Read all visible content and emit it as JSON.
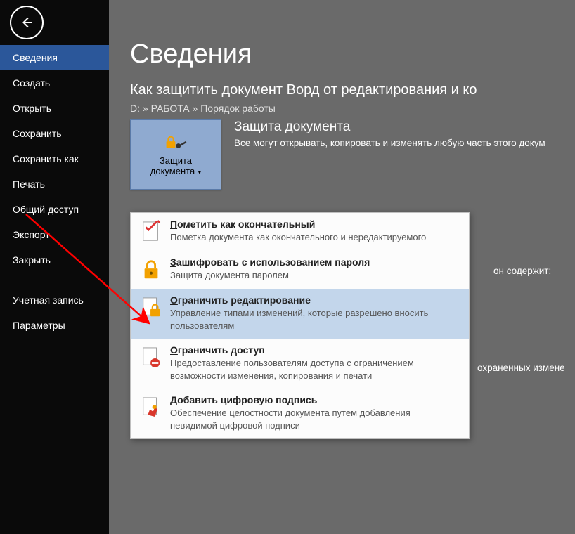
{
  "sidebar": {
    "items": [
      {
        "label": "Сведения",
        "selected": true
      },
      {
        "label": "Создать"
      },
      {
        "label": "Открыть"
      },
      {
        "label": "Сохранить"
      },
      {
        "label": "Сохранить как"
      },
      {
        "label": "Печать"
      },
      {
        "label": "Общий доступ"
      },
      {
        "label": "Экспорт"
      },
      {
        "label": "Закрыть"
      }
    ],
    "account_items": [
      {
        "label": "Учетная запись"
      },
      {
        "label": "Параметры"
      }
    ]
  },
  "page": {
    "title": "Сведения",
    "doc_title": "Как защитить документ Ворд от редактирования и ко",
    "breadcrumb": "D: » РАБОТА » Порядок работы"
  },
  "protect": {
    "button_line1": "Защита",
    "button_line2": "документа",
    "heading": "Защита документа",
    "description": "Все могут открывать, копировать и изменять любую часть этого докум"
  },
  "background_fragments": {
    "contains": "он содержит:",
    "unsaved": "охраненных измене"
  },
  "dropdown": {
    "items": [
      {
        "title_pre": "П",
        "title_rest": "ометить как окончательный",
        "desc": "Пометка документа как окончательного и нередактируемого",
        "icon": "mark-final-icon"
      },
      {
        "title_pre": "З",
        "title_rest": "ашифровать с использованием пароля",
        "desc": "Защита документа паролем",
        "icon": "encrypt-password-icon"
      },
      {
        "title_pre": "О",
        "title_rest": "граничить редактирование",
        "desc": "Управление типами изменений, которые разрешено вносить пользователям",
        "icon": "restrict-editing-icon",
        "highlight": true
      },
      {
        "title_pre": "О",
        "title_rest": "граничить доступ",
        "desc": "Предоставление пользователям доступа с ограничением возможности изменения, копирования и печати",
        "icon": "restrict-access-icon"
      },
      {
        "title_pre": "Д",
        "title_rest": "обавить цифровую подпись",
        "desc": "Обеспечение целостности документа путем добавления невидимой цифровой подписи",
        "icon": "digital-signature-icon"
      }
    ]
  }
}
